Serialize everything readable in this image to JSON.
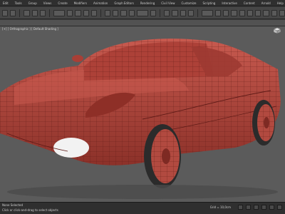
{
  "menubar": {
    "items": [
      "Edit",
      "Tools",
      "Group",
      "Views",
      "Create",
      "Modifiers",
      "Animation",
      "Graph Editors",
      "Rendering",
      "Civil View",
      "Customize",
      "Scripting",
      "Interactive",
      "Content",
      "Arnold",
      "Help"
    ]
  },
  "viewport": {
    "label": "[+] [ Orthographic ] [ Default Shading ]"
  },
  "status": {
    "selection": "None Selected",
    "prompt": "Click or click-and-drag to select objects",
    "grid": "Grid = 10,0cm"
  },
  "colors": {
    "model_fill": "#b2463f",
    "wire": "#5e1a16",
    "viewport_bg": "#5b5b5b"
  }
}
